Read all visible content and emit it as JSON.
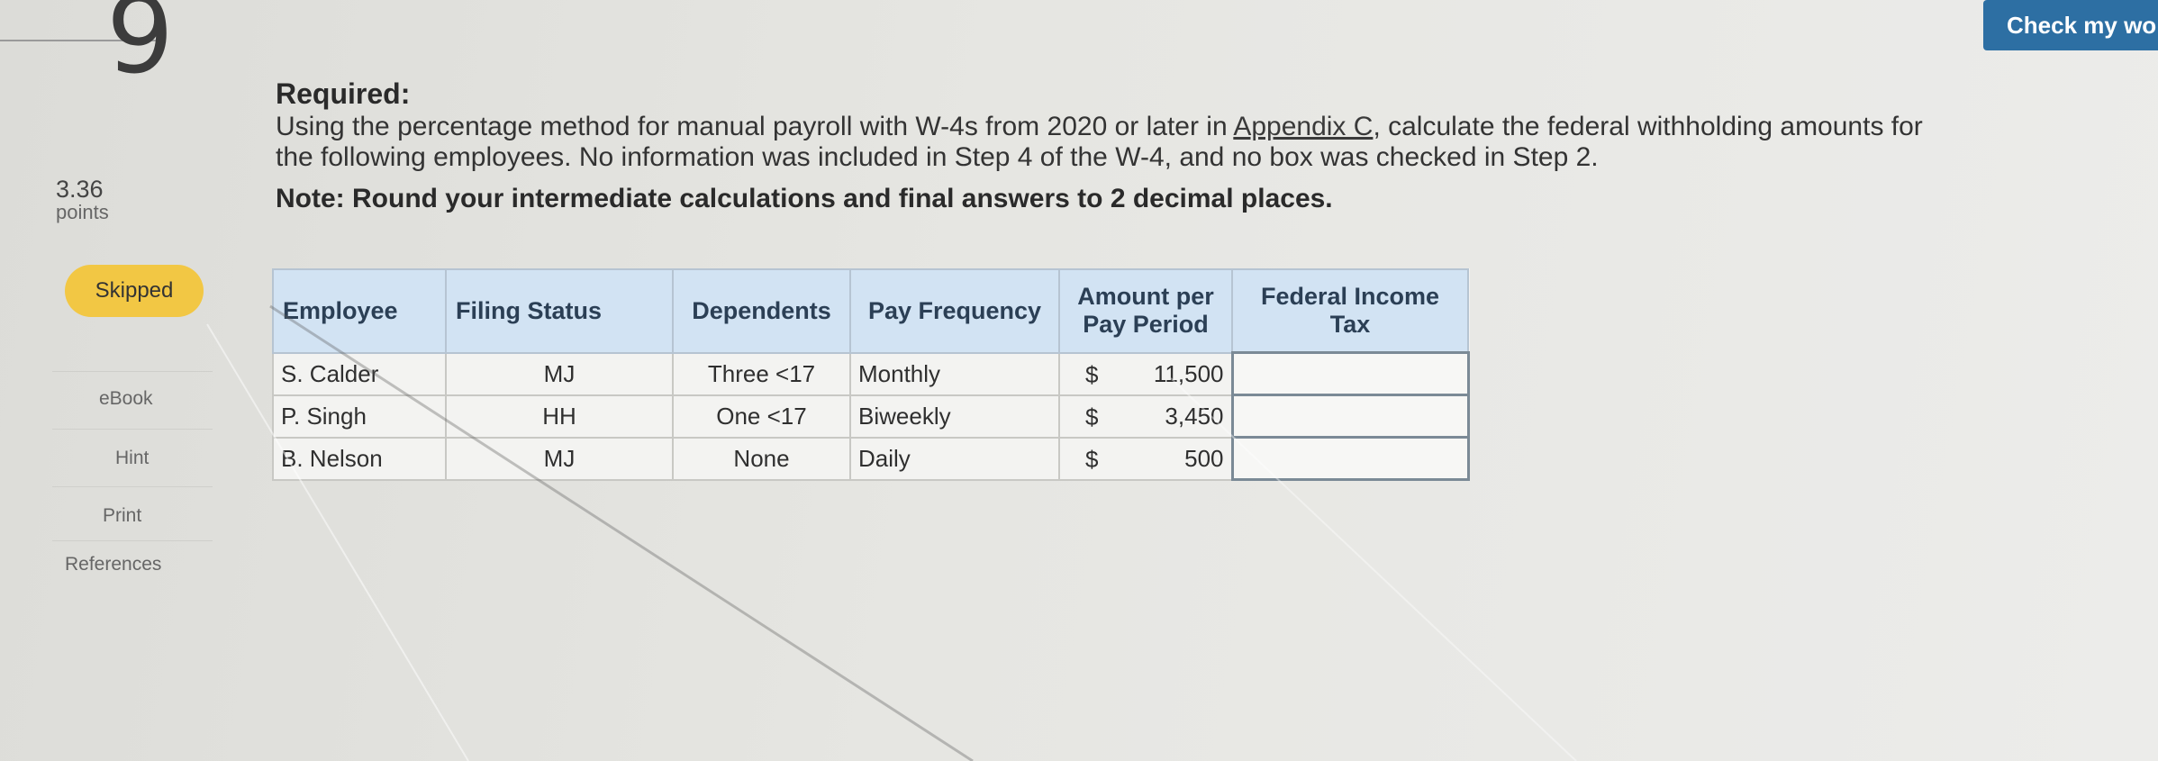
{
  "question": {
    "number": "9",
    "points": "3.36",
    "points_label": "points",
    "status": "Skipped"
  },
  "sidebar": {
    "links": [
      "eBook",
      "Hint",
      "Print",
      "References"
    ]
  },
  "header": {
    "check_button": "Check my wo"
  },
  "problem": {
    "required_label": "Required:",
    "instructions_before_link": "Using the percentage method for manual payroll with W-4s from 2020 or later in ",
    "link_text": "Appendix C",
    "instructions_after_link": ", calculate the federal withholding amounts for the following employees. No information was included in Step 4 of the W-4, and no box was checked in Step 2.",
    "note_label": "Note:",
    "note_text": "Round your intermediate calculations and final answers to 2 decimal places."
  },
  "table": {
    "headers": {
      "employee": "Employee",
      "filing_status": "Filing Status",
      "dependents": "Dependents",
      "pay_frequency": "Pay Frequency",
      "amount_per_pay_period": "Amount per Pay Period",
      "federal_income_tax": "Federal Income Tax"
    },
    "currency_symbol": "$",
    "rows": [
      {
        "employee": "S. Calder",
        "filing_status": "MJ",
        "dependents": "Three <17",
        "pay_frequency": "Monthly",
        "amount": "11,500",
        "federal_income_tax": ""
      },
      {
        "employee": "P. Singh",
        "filing_status": "HH",
        "dependents": "One <17",
        "pay_frequency": "Biweekly",
        "amount": "3,450",
        "federal_income_tax": ""
      },
      {
        "employee": "B. Nelson",
        "filing_status": "MJ",
        "dependents": "None",
        "pay_frequency": "Daily",
        "amount": "500",
        "federal_income_tax": ""
      }
    ]
  },
  "colors": {
    "check_button": "#2d6fa3",
    "skipped_badge": "#f2c744",
    "table_header": "#d2e3f3"
  }
}
